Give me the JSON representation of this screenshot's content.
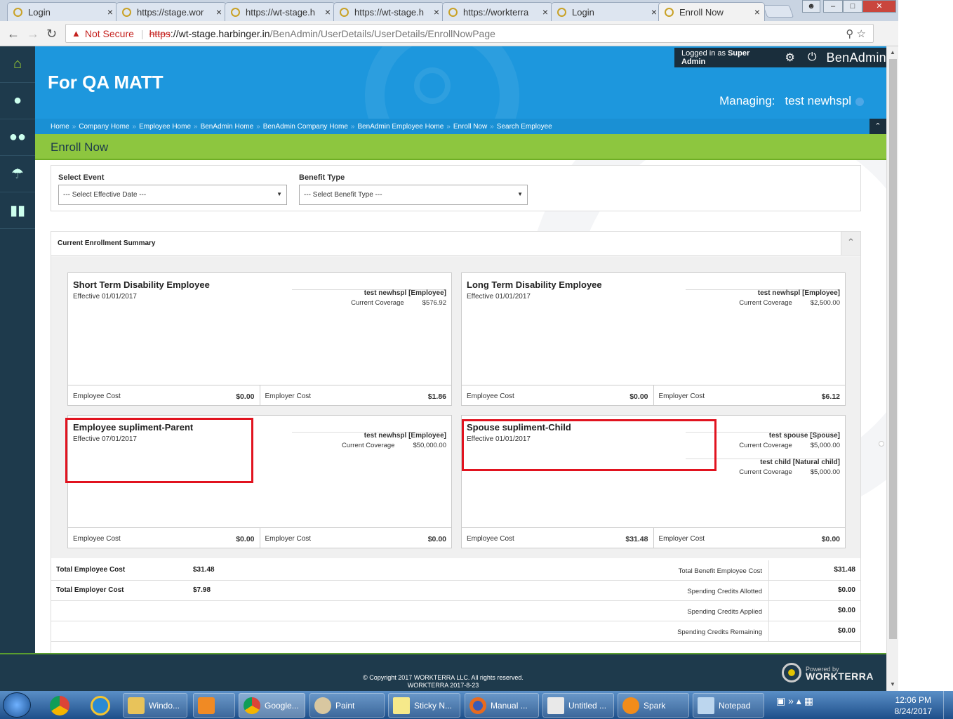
{
  "browser": {
    "tabs": [
      {
        "title": "Login"
      },
      {
        "title": "https://stage.wor"
      },
      {
        "title": "https://wt-stage.h"
      },
      {
        "title": "https://wt-stage.h"
      },
      {
        "title": "https://workterra"
      },
      {
        "title": "Login"
      },
      {
        "title": "Enroll Now"
      }
    ],
    "close_glyph": "×",
    "not_secure": "Not Secure",
    "url_protocol": "https",
    "url_host": "://wt-stage.harbinger.in",
    "url_path": "/BenAdmin/UserDetails/UserDetails/EnrollNowPage"
  },
  "header": {
    "company": "For QA MATT",
    "logged_in_prefix": "Logged in as",
    "logged_in_role": "Super Admin",
    "brand": "BenAdmin",
    "managing_label": "Managing:",
    "managing_user": "test newhspl"
  },
  "breadcrumbs": [
    "Home",
    "Company Home",
    "Employee Home",
    "BenAdmin Home",
    "BenAdmin Company Home",
    "BenAdmin Employee Home",
    "Enroll Now",
    "Search Employee"
  ],
  "page_title": "Enroll Now",
  "filters": {
    "event_label": "Select Event",
    "event_value": "--- Select Effective Date ---",
    "benefit_label": "Benefit Type",
    "benefit_value": "--- Select Benefit Type ---"
  },
  "summary": {
    "heading": "Current Enrollment Summary",
    "cards": [
      {
        "name": "Short Term Disability Employee",
        "effective": "Effective 01/01/2017",
        "member": "test newhspl [Employee]",
        "coverage_label": "Current Coverage",
        "coverage": "$576.92",
        "employee_cost_label": "Employee Cost",
        "employee_cost": "$0.00",
        "employer_cost_label": "Employer Cost",
        "employer_cost": "$1.86"
      },
      {
        "name": "Long Term Disability Employee",
        "effective": "Effective 01/01/2017",
        "member": "test newhspl [Employee]",
        "coverage_label": "Current Coverage",
        "coverage": "$2,500.00",
        "employee_cost_label": "Employee Cost",
        "employee_cost": "$0.00",
        "employer_cost_label": "Employer Cost",
        "employer_cost": "$6.12"
      },
      {
        "name": "Employee supliment-Parent",
        "effective": "Effective 07/01/2017",
        "member": "test newhspl [Employee]",
        "coverage_label": "Current Coverage",
        "coverage": "$50,000.00",
        "employee_cost_label": "Employee Cost",
        "employee_cost": "$0.00",
        "employer_cost_label": "Employer Cost",
        "employer_cost": "$0.00"
      },
      {
        "name": "Spouse supliment-Child",
        "effective": "Effective 01/01/2017",
        "member": "test spouse [Spouse]",
        "coverage_label": "Current Coverage",
        "coverage": "$5,000.00",
        "member2": "test child [Natural child]",
        "coverage2": "$5,000.00",
        "employee_cost_label": "Employee Cost",
        "employee_cost": "$31.48",
        "employer_cost_label": "Employer Cost",
        "employer_cost": "$0.00"
      }
    ],
    "totals": [
      {
        "label": "Total Employee Cost",
        "value": "$31.48",
        "label2": "Total Benefit Employee Cost",
        "value2": "$31.48"
      },
      {
        "label": "Total Employer Cost",
        "value": "$7.98",
        "label2": "Spending Credits Allotted",
        "value2": "$0.00"
      },
      {
        "label": "",
        "value": "",
        "label2": "Spending Credits Applied",
        "value2": "$0.00"
      },
      {
        "label": "",
        "value": "",
        "label2": "Spending Credits Remaining",
        "value2": "$0.00"
      }
    ]
  },
  "footer": {
    "copyright": "© Copyright 2017 WORKTERRA LLC. All rights reserved.",
    "build": "WORKTERRA 2017-8-23",
    "powered_by": "Powered by",
    "powered_brand": "WORKTERRA"
  },
  "taskbar": {
    "items": [
      "Windo...",
      "Google...",
      "Paint",
      "Sticky N...",
      "Manual ...",
      "Untitled ...",
      "Spark",
      "Notepad"
    ],
    "time": "12:06 PM",
    "date": "8/24/2017"
  },
  "colors": {
    "header_blue": "#1d97dd",
    "title_green": "#8dc63f",
    "sidebar": "#1e3a4c",
    "highlight_red": "#e1131f"
  }
}
